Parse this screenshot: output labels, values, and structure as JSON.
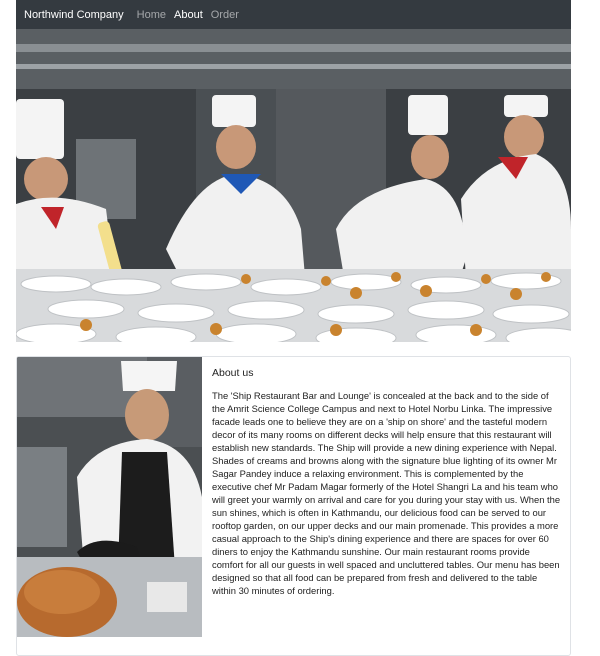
{
  "navbar": {
    "brand": "Northwind Company",
    "links": [
      {
        "label": "Home",
        "active": false
      },
      {
        "label": "About",
        "active": true
      },
      {
        "label": "Order",
        "active": false
      }
    ]
  },
  "hero": {
    "image": "chefs-plating-desserts-photo"
  },
  "about": {
    "image": "chef-carving-turkey-photo",
    "title": "About us",
    "paragraph1": "The 'Ship Restaurant Bar and Lounge' is concealed at the back and to the side of the Amrit Science College Campus and next to Hotel Norbu Linka. The impressive facade leads one to believe they are on a 'ship on shore' and the tasteful modern decor of its many rooms on different decks will help ensure that this restaurant will establish new standards. The Ship will provide a new dining experience with Nepal.",
    "paragraph2": "Shades of creams and browns along with the signature blue lighting of its owner Mr Sagar Pandey induce a relaxing environment. This is complemented by the executive chef Mr Padam Magar formerly of the Hotel Shangri La and his team who will greet your warmly on arrival and care for you during your stay with us. When the sun shines, which is often in Kathmandu, our delicious food can be served to our rooftop garden, on our upper decks and our main promenade. This provides a more casual approach to the Ship's dining experience and there are spaces for over 60 diners to enjoy the Kathmandu sunshine. Our main restaurant rooms provide comfort for all our guests in well spaced and uncluttered tables. Our menu has been designed so that all food can be prepared from fresh and delivered to the table within 30 minutes of ordering."
  }
}
